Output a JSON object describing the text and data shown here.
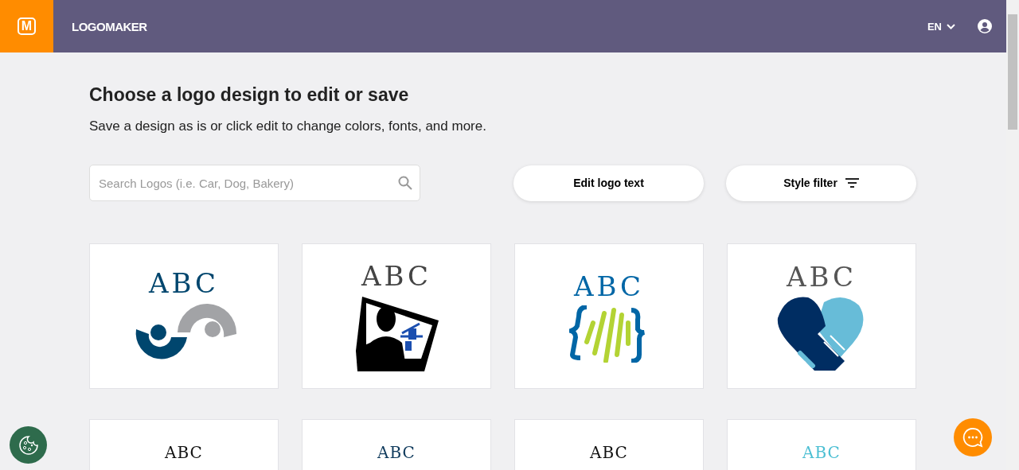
{
  "header": {
    "logo_mark": "M",
    "brand": "LOGOMAKER",
    "language": "EN"
  },
  "heading": "Choose a logo design to edit or save",
  "subheading": "Save a design as is or click edit to change colors, fonts, and more.",
  "search": {
    "placeholder": "Search Logos (i.e. Car, Dog, Bakery)"
  },
  "buttons": [
    {
      "label": "Edit logo text",
      "kind": "plain"
    },
    {
      "label": "Style filter",
      "kind": "filter"
    }
  ],
  "logos": [
    {
      "text": "ABC",
      "color": "#00466e",
      "kind": "arcs"
    },
    {
      "text": "ABC",
      "color": "#444444",
      "kind": "monitor"
    },
    {
      "text": "ABC",
      "color": "#0066a6",
      "kind": "braces"
    },
    {
      "text": "ABC",
      "color": "#555555",
      "kind": "handshake"
    },
    {
      "text": "ABC",
      "color": "#111111",
      "kind": "partial"
    },
    {
      "text": "ABC",
      "color": "#0f3a5c",
      "kind": "partial"
    },
    {
      "text": "ABC",
      "color": "#111111",
      "kind": "partial"
    },
    {
      "text": "ABC",
      "color": "#4cbfd3",
      "kind": "partial"
    }
  ]
}
